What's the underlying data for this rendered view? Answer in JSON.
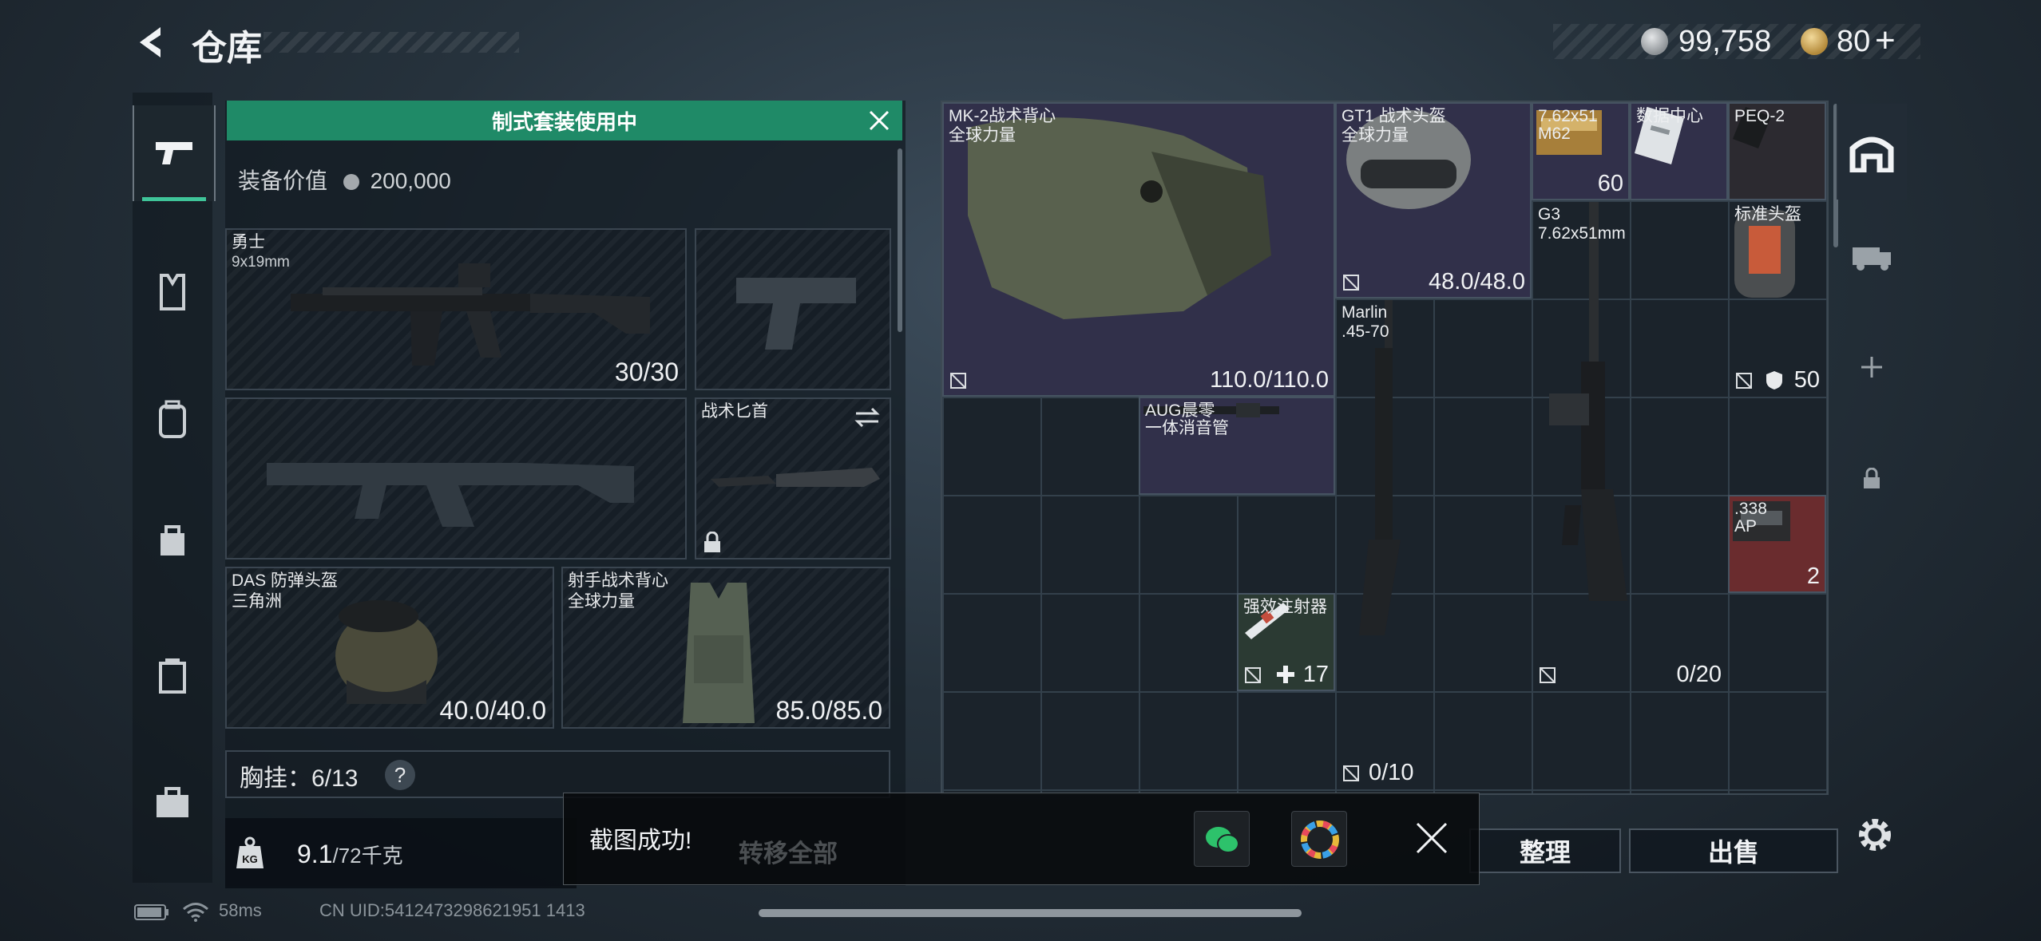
{
  "header": {
    "title": "仓库"
  },
  "currency": {
    "coins": "99,758",
    "tickets": "80",
    "plus": "+"
  },
  "loadout": {
    "banner": "制式套装使用中",
    "equip_value_label": "装备价值",
    "equip_value": "200,000",
    "primary": {
      "name": "勇士",
      "caliber": "9x19mm",
      "ammo": "30/30"
    },
    "knife": {
      "name": "战术匕首"
    },
    "helmet": {
      "name": "DAS 防弹头盔",
      "faction": "三角洲",
      "durability": "40.0/40.0"
    },
    "vest": {
      "name": "射手战术背心",
      "faction": "全球力量",
      "durability": "85.0/85.0"
    },
    "chest_rig": "胸挂：6/13",
    "chest_help": "?",
    "weight": "9.1",
    "weight_max": "/72千克"
  },
  "warehouse": {
    "items": [
      {
        "name": "MK-2战术背心",
        "sub": "全球力量",
        "value": "110.0/110.0"
      },
      {
        "name": "GT1 战术头盔",
        "sub": "全球力量",
        "value": "48.0/48.0"
      },
      {
        "name": "7.62x51",
        "sub": "M62",
        "value": "60"
      },
      {
        "name": "数据中心",
        "sub": "",
        "value": ""
      },
      {
        "name": "PEQ-2",
        "sub": "",
        "value": ""
      },
      {
        "name": "G3",
        "sub": "7.62x51mm",
        "value": "0/20"
      },
      {
        "name": "标准头盔",
        "sub": "",
        "value": "50"
      },
      {
        "name": "Marlin",
        "sub": ".45-70",
        "value": "0/10"
      },
      {
        "name": "AUG晨零",
        "sub": "一体消音管",
        "value": ""
      },
      {
        "name": "强效注射器",
        "sub": "",
        "value": "17"
      },
      {
        "name": ".338",
        "sub": "AP",
        "value": "2"
      }
    ]
  },
  "buttons": {
    "sort": "整理",
    "sell": "出售",
    "transfer_all": "转移全部"
  },
  "toast": {
    "text": "截图成功!"
  },
  "status": {
    "ping": "58ms",
    "uid": "CN UID:5412473298621951 1413"
  },
  "colors": {
    "accent": "#1f8a67",
    "purple_cell": "#31304a",
    "red_cell": "#6a2c2e"
  }
}
